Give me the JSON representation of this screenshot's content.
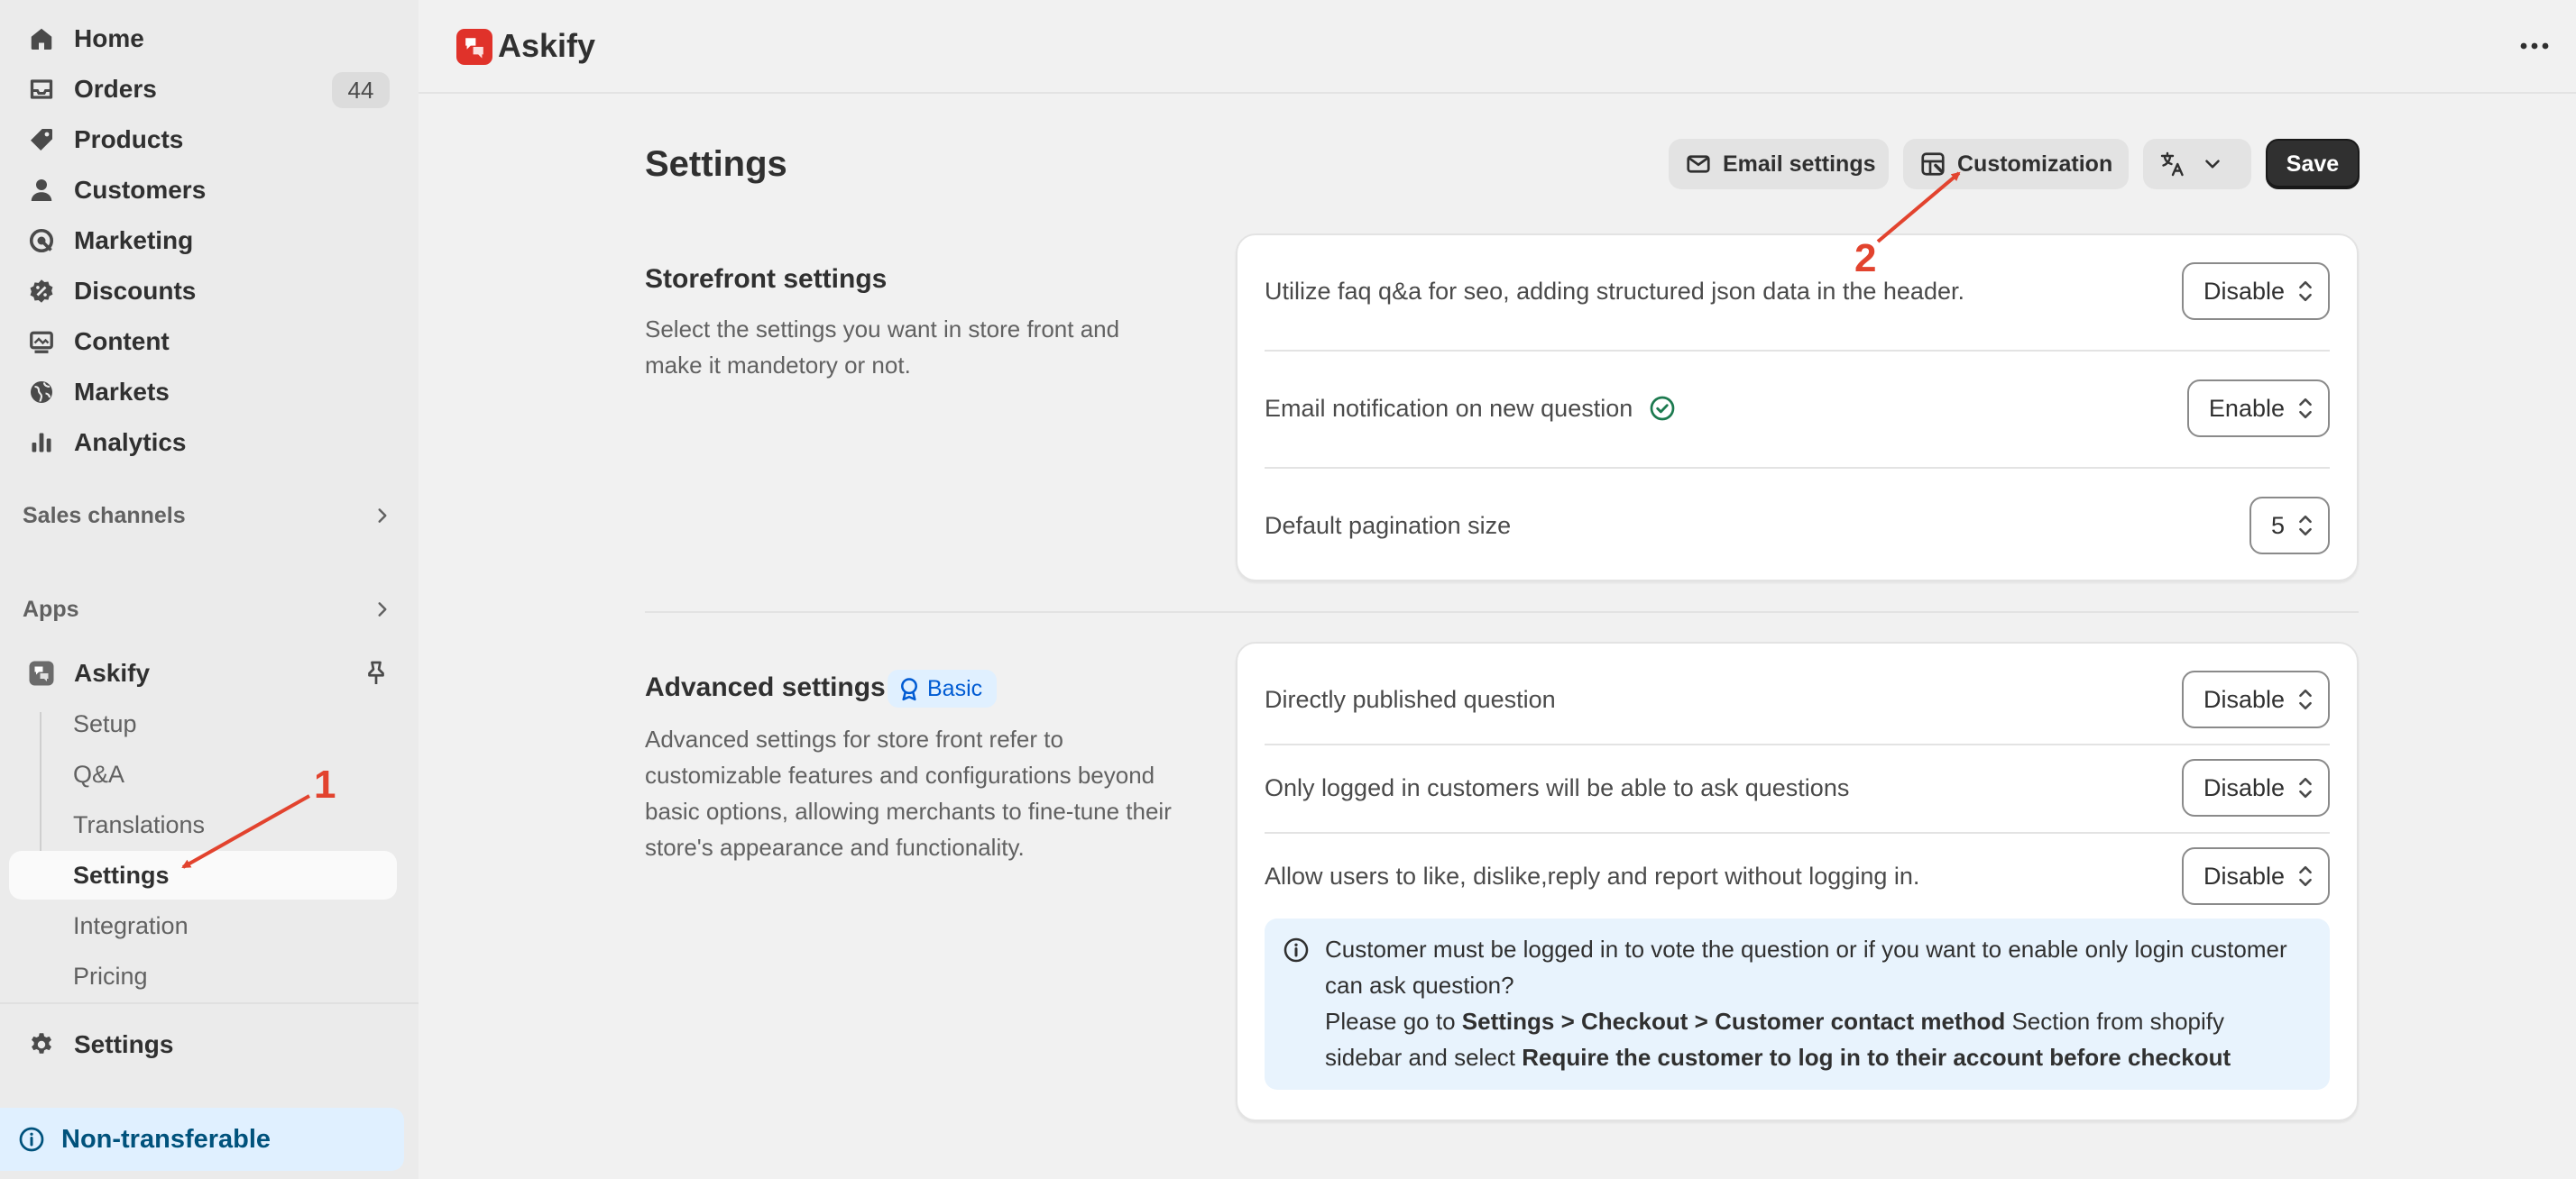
{
  "sidebar": {
    "items": [
      {
        "label": "Home",
        "icon": "home-icon"
      },
      {
        "label": "Orders",
        "icon": "inbox-icon",
        "badge": "44"
      },
      {
        "label": "Products",
        "icon": "tag-icon"
      },
      {
        "label": "Customers",
        "icon": "person-icon"
      },
      {
        "label": "Marketing",
        "icon": "target-icon"
      },
      {
        "label": "Discounts",
        "icon": "discount-icon"
      },
      {
        "label": "Content",
        "icon": "content-icon"
      },
      {
        "label": "Markets",
        "icon": "globe-icon"
      },
      {
        "label": "Analytics",
        "icon": "chart-bars-icon"
      }
    ],
    "sales_channels": "Sales channels",
    "apps": "Apps",
    "app_name": "Askify",
    "app_sub_items": [
      "Setup",
      "Q&A",
      "Translations",
      "Settings",
      "Integration",
      "Pricing"
    ],
    "settings": "Settings",
    "non_transferable": "Non-transferable"
  },
  "header": {
    "app_title": "Askify"
  },
  "page": {
    "title": "Settings",
    "buttons": {
      "email_settings": "Email settings",
      "customization": "Customization",
      "save": "Save"
    }
  },
  "storefront": {
    "title": "Storefront settings",
    "description": "Select the settings you want in store front and make it mandetory or not.",
    "rows": [
      {
        "label": "Utilize faq q&a for seo, adding structured json data in the header.",
        "value": "Disable"
      },
      {
        "label": "Email notification on new question",
        "value": "Enable"
      },
      {
        "label": "Default pagination size",
        "value": "5"
      }
    ]
  },
  "advanced": {
    "title": "Advanced settings",
    "badge": "Basic",
    "description": "Advanced settings for store front refer to customizable features and configurations beyond basic options, allowing merchants to fine-tune their store's appearance and functionality.",
    "rows": [
      {
        "label": "Directly published question",
        "value": "Disable"
      },
      {
        "label": "Only logged in customers will be able to ask questions",
        "value": "Disable"
      },
      {
        "label": "Allow users to like, dislike,reply and report without logging in.",
        "value": "Disable"
      }
    ],
    "info": {
      "line1": "Customer must be logged in to vote the question or if you want to enable only login customer can ask question?",
      "prefix": "Please go to ",
      "path": "Settings > Checkout > Customer contact method",
      "middle": " Section from shopify sidebar and select ",
      "option": "Require the customer to log in to their account before checkout"
    }
  },
  "annotations": {
    "step1": "1",
    "step2": "2",
    "color": "#e2432e"
  }
}
